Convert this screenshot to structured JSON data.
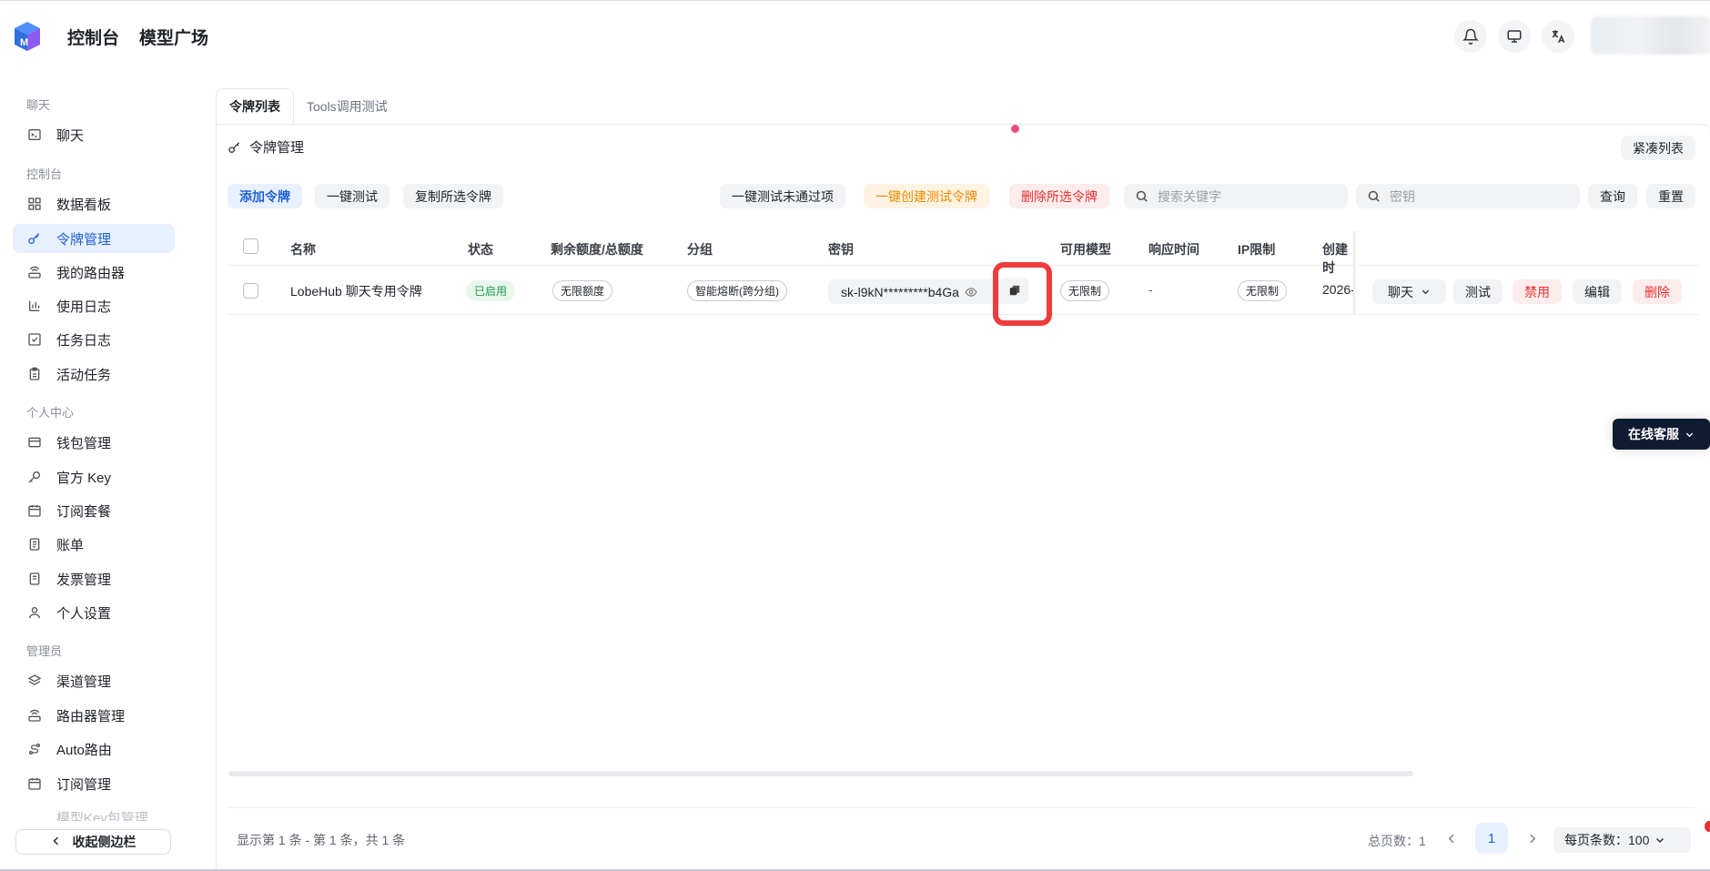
{
  "header": {
    "nav": [
      "控制台",
      "模型广场"
    ]
  },
  "sidebar": {
    "sections": [
      {
        "label": "聊天",
        "items": [
          {
            "label": "聊天",
            "icon": "terminal-icon"
          }
        ]
      },
      {
        "label": "控制台",
        "items": [
          {
            "label": "数据看板",
            "icon": "dashboard-icon"
          },
          {
            "label": "令牌管理",
            "icon": "key-icon",
            "active": true
          },
          {
            "label": "我的路由器",
            "icon": "router-icon"
          },
          {
            "label": "使用日志",
            "icon": "bar-chart-icon"
          },
          {
            "label": "任务日志",
            "icon": "check-square-icon"
          },
          {
            "label": "活动任务",
            "icon": "clipboard-icon"
          }
        ]
      },
      {
        "label": "个人中心",
        "items": [
          {
            "label": "钱包管理",
            "icon": "wallet-icon"
          },
          {
            "label": "官方 Key",
            "icon": "key-icon"
          },
          {
            "label": "订阅套餐",
            "icon": "calendar-icon"
          },
          {
            "label": "账单",
            "icon": "document-icon"
          },
          {
            "label": "发票管理",
            "icon": "invoice-icon"
          },
          {
            "label": "个人设置",
            "icon": "user-icon"
          }
        ]
      },
      {
        "label": "管理员",
        "items": [
          {
            "label": "渠道管理",
            "icon": "layers-icon"
          },
          {
            "label": "路由器管理",
            "icon": "router-icon"
          },
          {
            "label": "Auto路由",
            "icon": "route-icon"
          },
          {
            "label": "订阅管理",
            "icon": "calendar-icon"
          }
        ]
      }
    ],
    "partial_item": "模型Key包管理",
    "collapse_label": "收起侧边栏"
  },
  "tabs": [
    "令牌列表",
    "Tools调用测试"
  ],
  "panel": {
    "title": "令牌管理",
    "compact_label": "紧凑列表"
  },
  "toolbar": {
    "add": "添加令牌",
    "test_all": "一键测试",
    "copy_selected": "复制所选令牌",
    "test_failed": "一键测试未通过项",
    "create_test": "一键创建测试令牌",
    "delete_selected": "删除所选令牌",
    "search_placeholder": "搜索关键字",
    "key_placeholder": "密钥",
    "query": "查询",
    "reset": "重置"
  },
  "table": {
    "headers": [
      "名称",
      "状态",
      "剩余额度/总额度",
      "分组",
      "密钥",
      "可用模型",
      "响应时间",
      "IP限制",
      "创建时"
    ],
    "rows": [
      {
        "name": "LobeHub 聊天专用令牌",
        "status": "已启用",
        "quota": "无限额度",
        "group": "智能熔断(跨分组)",
        "key": "sk-l9kN*********b4Ga",
        "models": "无限制",
        "response_time": "-",
        "ip_limit": "无限制",
        "created": "2026-",
        "actions": {
          "chat": "聊天",
          "test": "测试",
          "disable": "禁用",
          "edit": "编辑",
          "delete": "删除"
        }
      }
    ]
  },
  "footer": {
    "summary": "显示第 1 条 - 第 1 条，共 1 条",
    "total_pages": "总页数：1",
    "current_page": "1",
    "per_page": "每页条数：100"
  },
  "support_label": "在线客服",
  "colors": {
    "accent": "#1f5fd6",
    "danger": "#e5312f",
    "warning": "#f08a00",
    "success": "#1f9a4b",
    "highlight": "#ef3b3b"
  }
}
